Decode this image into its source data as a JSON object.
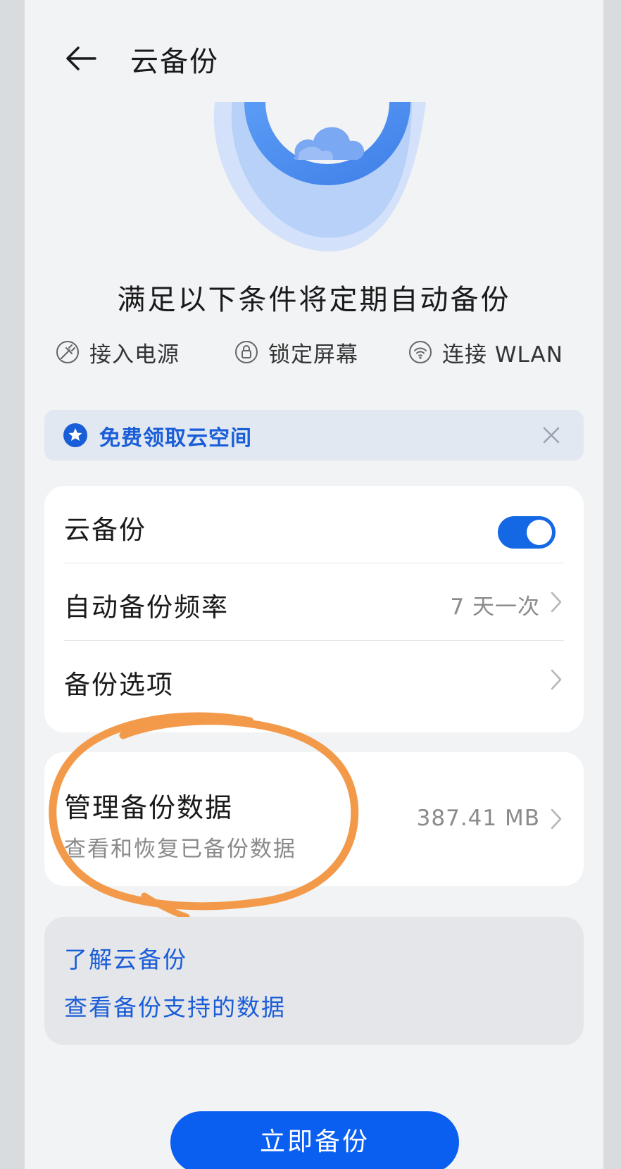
{
  "header": {
    "title": "云备份",
    "back_icon": "back-arrow-icon"
  },
  "hero": {
    "icon": "cloud-icon",
    "headline": "满足以下条件将定期自动备份"
  },
  "conditions": [
    {
      "icon": "plug-icon",
      "label": "接入电源"
    },
    {
      "icon": "lock-icon",
      "label": "锁定屏幕"
    },
    {
      "icon": "wifi-icon",
      "label": "连接 WLAN"
    }
  ],
  "promo": {
    "icon": "star-badge-icon",
    "label": "免费领取云空间",
    "close_icon": "close-icon"
  },
  "settings": {
    "cloud_backup": {
      "label": "云备份",
      "enabled": true
    },
    "frequency": {
      "label": "自动备份频率",
      "value": "7 天一次"
    },
    "options": {
      "label": "备份选项"
    }
  },
  "manage": {
    "title": "管理备份数据",
    "subtitle": "查看和恢复已备份数据",
    "size": "387.41 MB"
  },
  "links": {
    "learn": "了解云备份",
    "supported": "查看备份支持的数据"
  },
  "action": {
    "label": "立即备份"
  },
  "colors": {
    "accent": "#1468e4",
    "link": "#1a5dd8",
    "annotation": "#f39a4a",
    "background": "#f1f3f5"
  }
}
